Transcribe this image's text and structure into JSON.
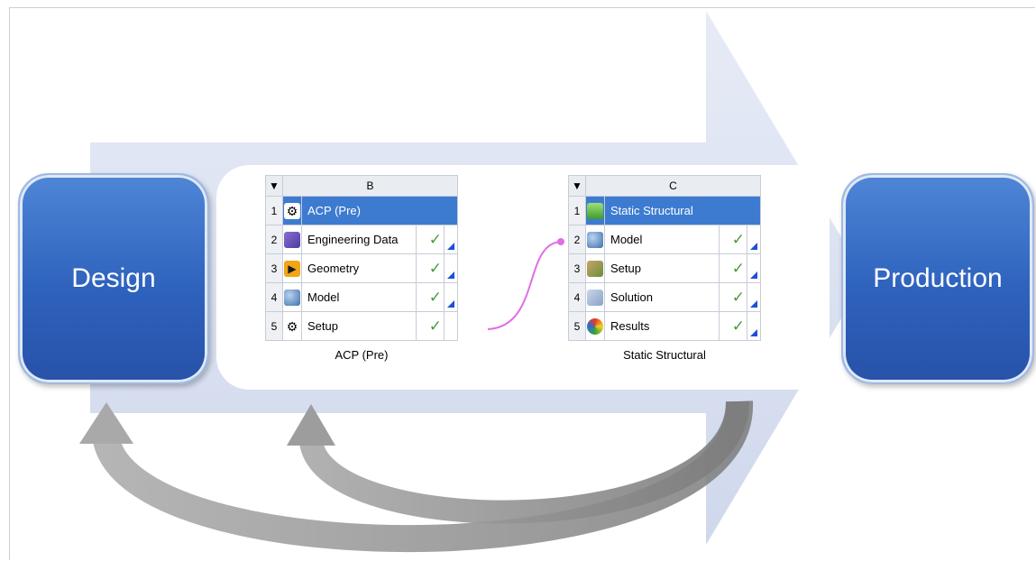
{
  "boxes": {
    "left": "Design",
    "right": "Production"
  },
  "systems": [
    {
      "column": "B",
      "caption": "ACP (Pre)",
      "rows": [
        {
          "num": "1",
          "label": "ACP (Pre)",
          "icon": "gears-icon",
          "check": "",
          "selected": true
        },
        {
          "num": "2",
          "label": "Engineering Data",
          "icon": "engineering-data-icon",
          "check": "✓"
        },
        {
          "num": "3",
          "label": "Geometry",
          "icon": "geometry-icon",
          "check": "✓"
        },
        {
          "num": "4",
          "label": "Model",
          "icon": "model-icon",
          "check": "✓"
        },
        {
          "num": "5",
          "label": "Setup",
          "icon": "gears-icon",
          "check": "✓"
        }
      ]
    },
    {
      "column": "C",
      "caption": "Static Structural",
      "rows": [
        {
          "num": "1",
          "label": "Static Structural",
          "icon": "static-structural-icon",
          "check": "",
          "selected": true
        },
        {
          "num": "2",
          "label": "Model",
          "icon": "model-icon",
          "check": "✓"
        },
        {
          "num": "3",
          "label": "Setup",
          "icon": "setup-icon",
          "check": "✓"
        },
        {
          "num": "4",
          "label": "Solution",
          "icon": "solution-icon",
          "check": "✓"
        },
        {
          "num": "5",
          "label": "Results",
          "icon": "results-icon",
          "check": "✓"
        }
      ]
    }
  ],
  "colors": {
    "box_blue": "#2e62bd",
    "arrow_fill": "#dde4f2",
    "link_color": "#e36de3",
    "feedback_gray": "#8c8c8c"
  }
}
